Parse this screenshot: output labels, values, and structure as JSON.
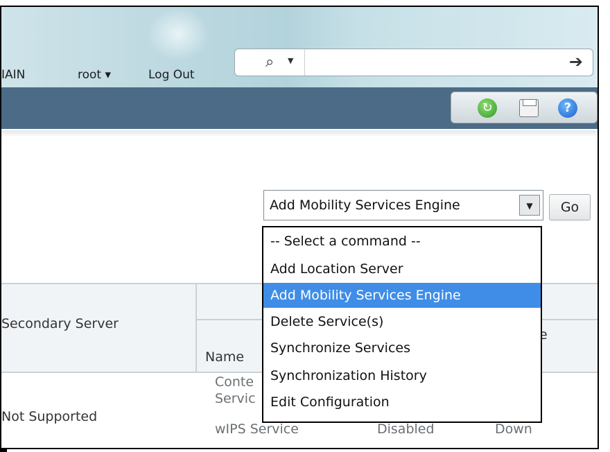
{
  "header": {
    "domain_partial": "IAIN",
    "user_label": "root ▾",
    "logout_label": "Log Out",
    "search_value": "",
    "search_icon": "magnifier-icon",
    "search_go_icon": "arrow-right-icon"
  },
  "toolbar": {
    "icons": [
      "refresh-icon",
      "print-icon",
      "help-icon"
    ]
  },
  "command": {
    "selected": "Add Mobility Services Engine",
    "go_label": "Go",
    "options": [
      "-- Select a command --",
      "Add Location Server",
      "Add Mobility Services Engine",
      "Delete Service(s)",
      "Synchronize Services",
      "Synchronization History",
      "Edit Configuration"
    ],
    "selected_index": 2
  },
  "table": {
    "col_secondary_server": "Secondary Server",
    "col_name": "Name",
    "col_partial_right": "e",
    "row1_secondary": "Not Supported",
    "row1_service_a_line1": "Conte",
    "row1_service_a_line2": "Servic",
    "row1_service_b": "wIPS Service",
    "row1_service_b_admin": "Disabled",
    "row1_service_b_status": "Down"
  },
  "colors": {
    "navbar": "#4c6b86",
    "selection": "#3f8de6"
  }
}
